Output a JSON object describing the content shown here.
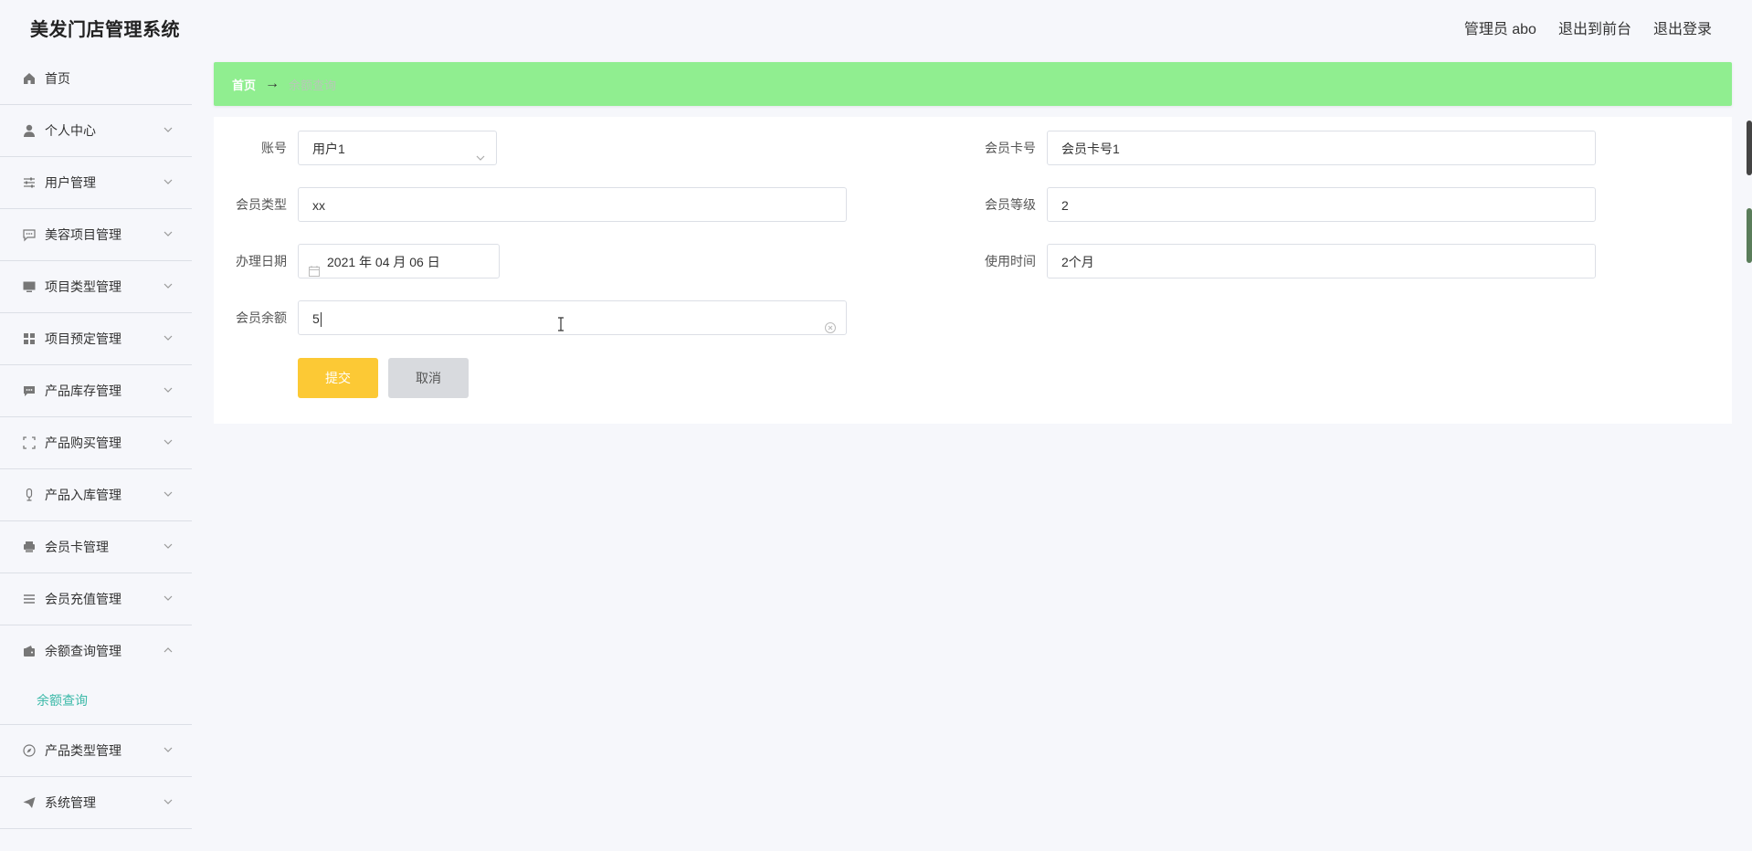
{
  "header": {
    "app_title": "美发门店管理系统",
    "admin_label": "管理员 abo",
    "to_frontend": "退出到前台",
    "logout": "退出登录"
  },
  "sidebar": {
    "items": [
      {
        "label": "首页",
        "icon": "home-icon"
      },
      {
        "label": "个人中心",
        "icon": "user-icon"
      },
      {
        "label": "用户管理",
        "icon": "sliders-icon"
      },
      {
        "label": "美容项目管理",
        "icon": "chat-icon"
      },
      {
        "label": "项目类型管理",
        "icon": "monitor-icon"
      },
      {
        "label": "项目预定管理",
        "icon": "grid-icon"
      },
      {
        "label": "产品库存管理",
        "icon": "message-icon"
      },
      {
        "label": "产品购买管理",
        "icon": "fullscreen-icon"
      },
      {
        "label": "产品入库管理",
        "icon": "microphone-icon"
      },
      {
        "label": "会员卡管理",
        "icon": "printer-icon"
      },
      {
        "label": "会员充值管理",
        "icon": "list-icon"
      },
      {
        "label": "余额查询管理",
        "icon": "wallet-icon"
      },
      {
        "label": "产品类型管理",
        "icon": "compass-icon"
      },
      {
        "label": "系统管理",
        "icon": "send-icon"
      }
    ],
    "active_submenu": "余额查询"
  },
  "breadcrumb": {
    "home": "首页",
    "separator": "→",
    "current": "余额查询"
  },
  "form": {
    "account_label": "账号",
    "account_value": "用户1",
    "card_no_label": "会员卡号",
    "card_no_value": "会员卡号1",
    "member_type_label": "会员类型",
    "member_type_value": "xx",
    "member_level_label": "会员等级",
    "member_level_value": "2",
    "date_label": "办理日期",
    "date_value": "2021 年 04 月 06 日",
    "usage_label": "使用时间",
    "usage_value": "2个月",
    "balance_label": "会员余额",
    "balance_value": "5",
    "submit": "提交",
    "cancel": "取消"
  },
  "colors": {
    "breadcrumb_bg": "#90ee90",
    "submit_bg": "#fcc935",
    "cancel_bg": "#d8dade",
    "active_submenu": "#3bb9a8"
  }
}
